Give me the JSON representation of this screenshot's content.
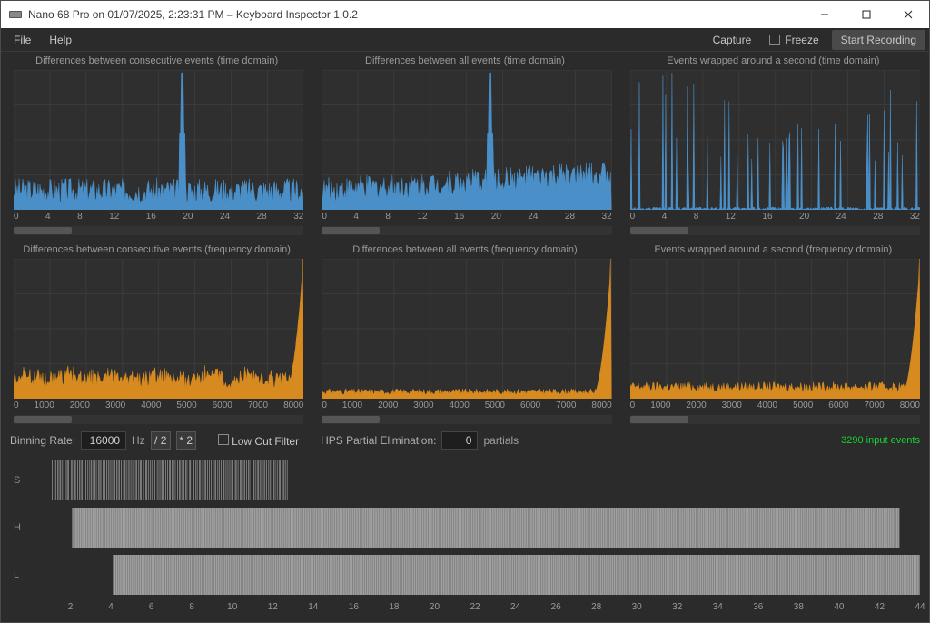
{
  "window": {
    "title": "Nano 68 Pro on 01/07/2025, 2:23:31 PM – Keyboard Inspector 1.0.2"
  },
  "menubar": {
    "file": "File",
    "help": "Help",
    "capture": "Capture",
    "freeze": "Freeze",
    "start_recording": "Start Recording"
  },
  "plots": [
    {
      "title": "Differences between consecutive events (time domain)",
      "color": "#4a8fc7"
    },
    {
      "title": "Differences between all events (time domain)",
      "color": "#4a8fc7"
    },
    {
      "title": "Events wrapped around a second (time domain)",
      "color": "#4a8fc7"
    },
    {
      "title": "Differences between consecutive events (frequency domain)",
      "color": "#d68a1f"
    },
    {
      "title": "Differences between all events (frequency domain)",
      "color": "#d68a1f"
    },
    {
      "title": "Events wrapped around a second (frequency domain)",
      "color": "#d68a1f"
    }
  ],
  "controls": {
    "binning_rate_label": "Binning Rate:",
    "binning_rate_value": "16000",
    "binning_rate_unit": "Hz",
    "div2": "/ 2",
    "mul2": "* 2",
    "low_cut": "Low Cut Filter",
    "hps_label": "HPS Partial Elimination:",
    "hps_value": "0",
    "hps_unit": "partials",
    "status": "3290 input events"
  },
  "timeline": {
    "rows": [
      "S",
      "H",
      "L"
    ]
  },
  "chart_data": [
    {
      "type": "bar",
      "title": "Differences between consecutive events (time domain)",
      "xlabel": "",
      "ylabel": "",
      "xlim": [
        0,
        32
      ],
      "ticks": [
        0,
        4,
        8,
        12,
        16,
        20,
        24,
        28,
        32
      ],
      "note": "dense noisy spectrum ~10-25% height with a tall spike at ≈18.6 reaching ~95%"
    },
    {
      "type": "bar",
      "title": "Differences between all events (time domain)",
      "xlabel": "",
      "ylabel": "",
      "xlim": [
        0,
        32
      ],
      "ticks": [
        0,
        4,
        8,
        12,
        16,
        20,
        24,
        28,
        32
      ],
      "note": "dense noisy spectrum rising toward right, tall spike at ≈18.6 (~100%), secondary rise 28-32"
    },
    {
      "type": "bar",
      "title": "Events wrapped around a second (time domain)",
      "xlabel": "",
      "ylabel": "",
      "xlim": [
        0,
        32
      ],
      "ticks": [
        0,
        4,
        8,
        12,
        16,
        20,
        24,
        28,
        32
      ],
      "note": "many sparse tall impulses across full range, heights vary 30-100%"
    },
    {
      "type": "bar",
      "title": "Differences between consecutive events (frequency domain)",
      "xlabel": "",
      "ylabel": "",
      "xlim": [
        0,
        8000
      ],
      "ticks": [
        0,
        1000,
        2000,
        3000,
        4000,
        5000,
        6000,
        7000,
        8000
      ],
      "note": "low noisy baseline (~8-15%) rising sharply to ~100% near 8000"
    },
    {
      "type": "bar",
      "title": "Differences between all events (frequency domain)",
      "xlabel": "",
      "ylabel": "",
      "xlim": [
        0,
        8000
      ],
      "ticks": [
        0,
        1000,
        2000,
        3000,
        4000,
        5000,
        6000,
        7000,
        8000
      ],
      "note": "very low flat baseline (~3-5%) rising sharply to ~100% near 8000"
    },
    {
      "type": "bar",
      "title": "Events wrapped around a second (frequency domain)",
      "xlabel": "",
      "ylabel": "",
      "xlim": [
        0,
        8000
      ],
      "ticks": [
        0,
        1000,
        2000,
        3000,
        4000,
        5000,
        6000,
        7000,
        8000
      ],
      "note": "low baseline (~5-8%) rising sharply to ~100% near 8000"
    }
  ],
  "timeline_data": {
    "xlim": [
      0,
      44
    ],
    "ticks": [
      2,
      4,
      6,
      8,
      10,
      12,
      14,
      16,
      18,
      20,
      22,
      24,
      26,
      28,
      30,
      32,
      34,
      36,
      38,
      40,
      42,
      44
    ],
    "rows": {
      "S": {
        "start": 1.1,
        "end": 12.8,
        "density": "sparse"
      },
      "H": {
        "start": 2.1,
        "end": 43.0,
        "density": "dense"
      },
      "L": {
        "start": 2.6,
        "end": 44.0,
        "density": "dense"
      }
    }
  }
}
